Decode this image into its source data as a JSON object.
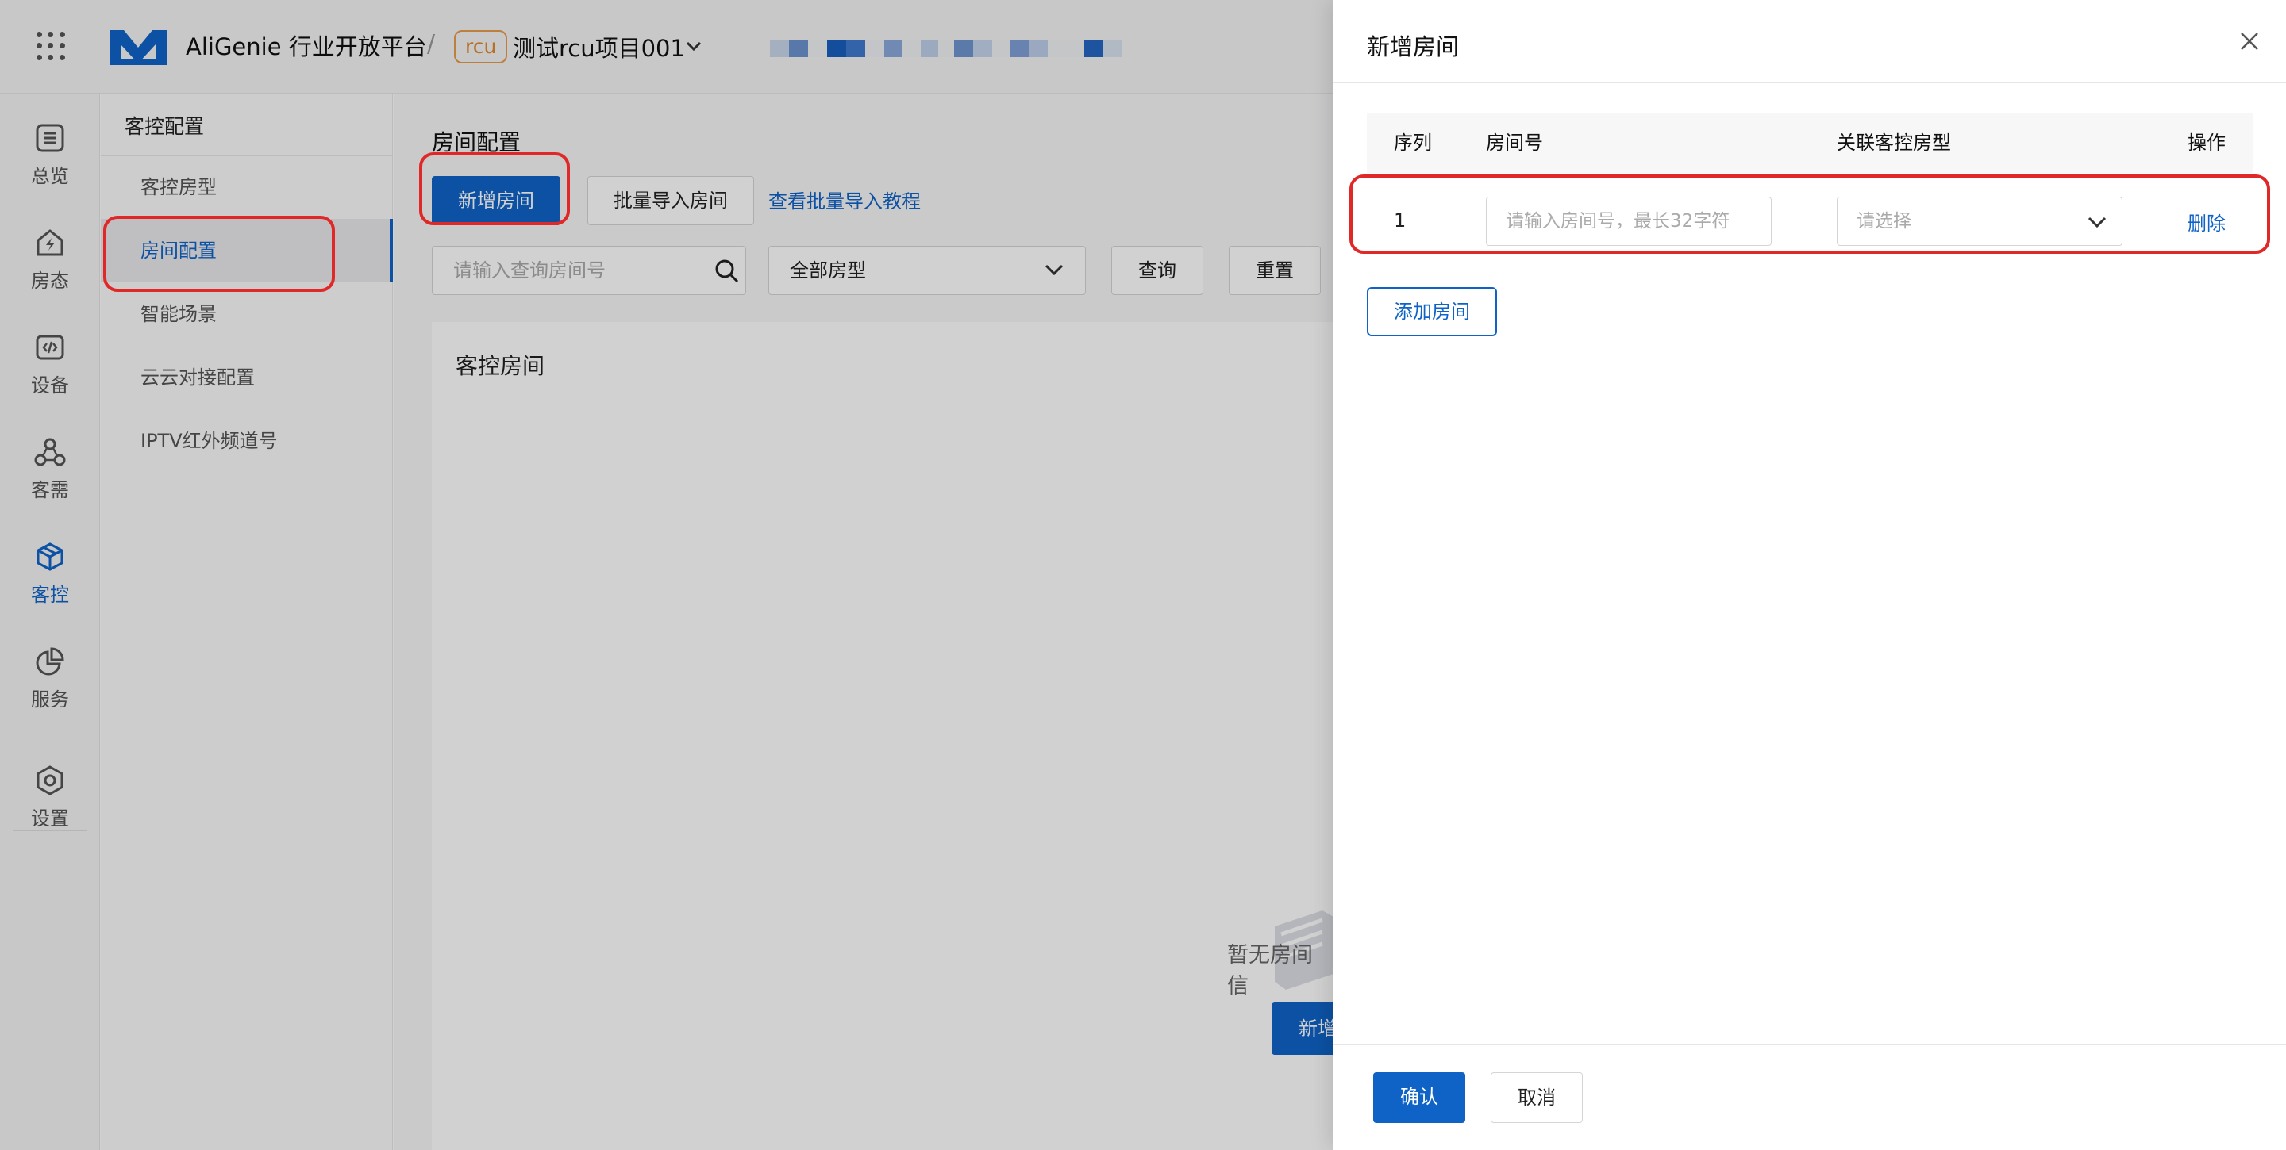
{
  "header": {
    "brand": "AliGenie 行业开放平台",
    "separator": "/",
    "project_tag": "rcu",
    "project_name": "测试rcu项目001"
  },
  "sidenav": {
    "items": [
      {
        "label": "总览",
        "icon": "overview-icon"
      },
      {
        "label": "房态",
        "icon": "room-status-icon"
      },
      {
        "label": "设备",
        "icon": "device-icon"
      },
      {
        "label": "客需",
        "icon": "guest-needs-icon"
      },
      {
        "label": "客控",
        "icon": "guest-control-icon",
        "active": true
      },
      {
        "label": "服务",
        "icon": "service-icon"
      },
      {
        "label": "设置",
        "icon": "settings-icon"
      }
    ]
  },
  "subnav": {
    "title": "客控配置",
    "items": [
      {
        "label": "客控房型"
      },
      {
        "label": "房间配置",
        "active": true
      },
      {
        "label": "智能场景"
      },
      {
        "label": "云云对接配置"
      },
      {
        "label": "IPTV红外频道号"
      }
    ]
  },
  "main": {
    "title": "房间配置",
    "add_room_btn": "新增房间",
    "batch_import_btn": "批量导入房间",
    "tutorial_link": "查看批量导入教程",
    "search_placeholder": "请输入查询房间号",
    "room_type_select": "全部房型",
    "query_btn": "查询",
    "reset_btn": "重置",
    "card_title": "客控房间",
    "empty_text": "暂无房间信",
    "empty_btn": "新增"
  },
  "drawer": {
    "title": "新增房间",
    "columns": {
      "index": "序列",
      "room_no": "房间号",
      "room_type": "关联客控房型",
      "action": "操作"
    },
    "rows": [
      {
        "index": "1",
        "room_placeholder": "请输入房间号，最长32字符",
        "type_placeholder": "请选择",
        "delete": "删除"
      }
    ],
    "add_row_btn": "添加房间",
    "confirm_btn": "确认",
    "cancel_btn": "取消"
  },
  "colors": {
    "accent": "#0f63c7",
    "highlight": "#e02828",
    "tag": "#e08930"
  }
}
